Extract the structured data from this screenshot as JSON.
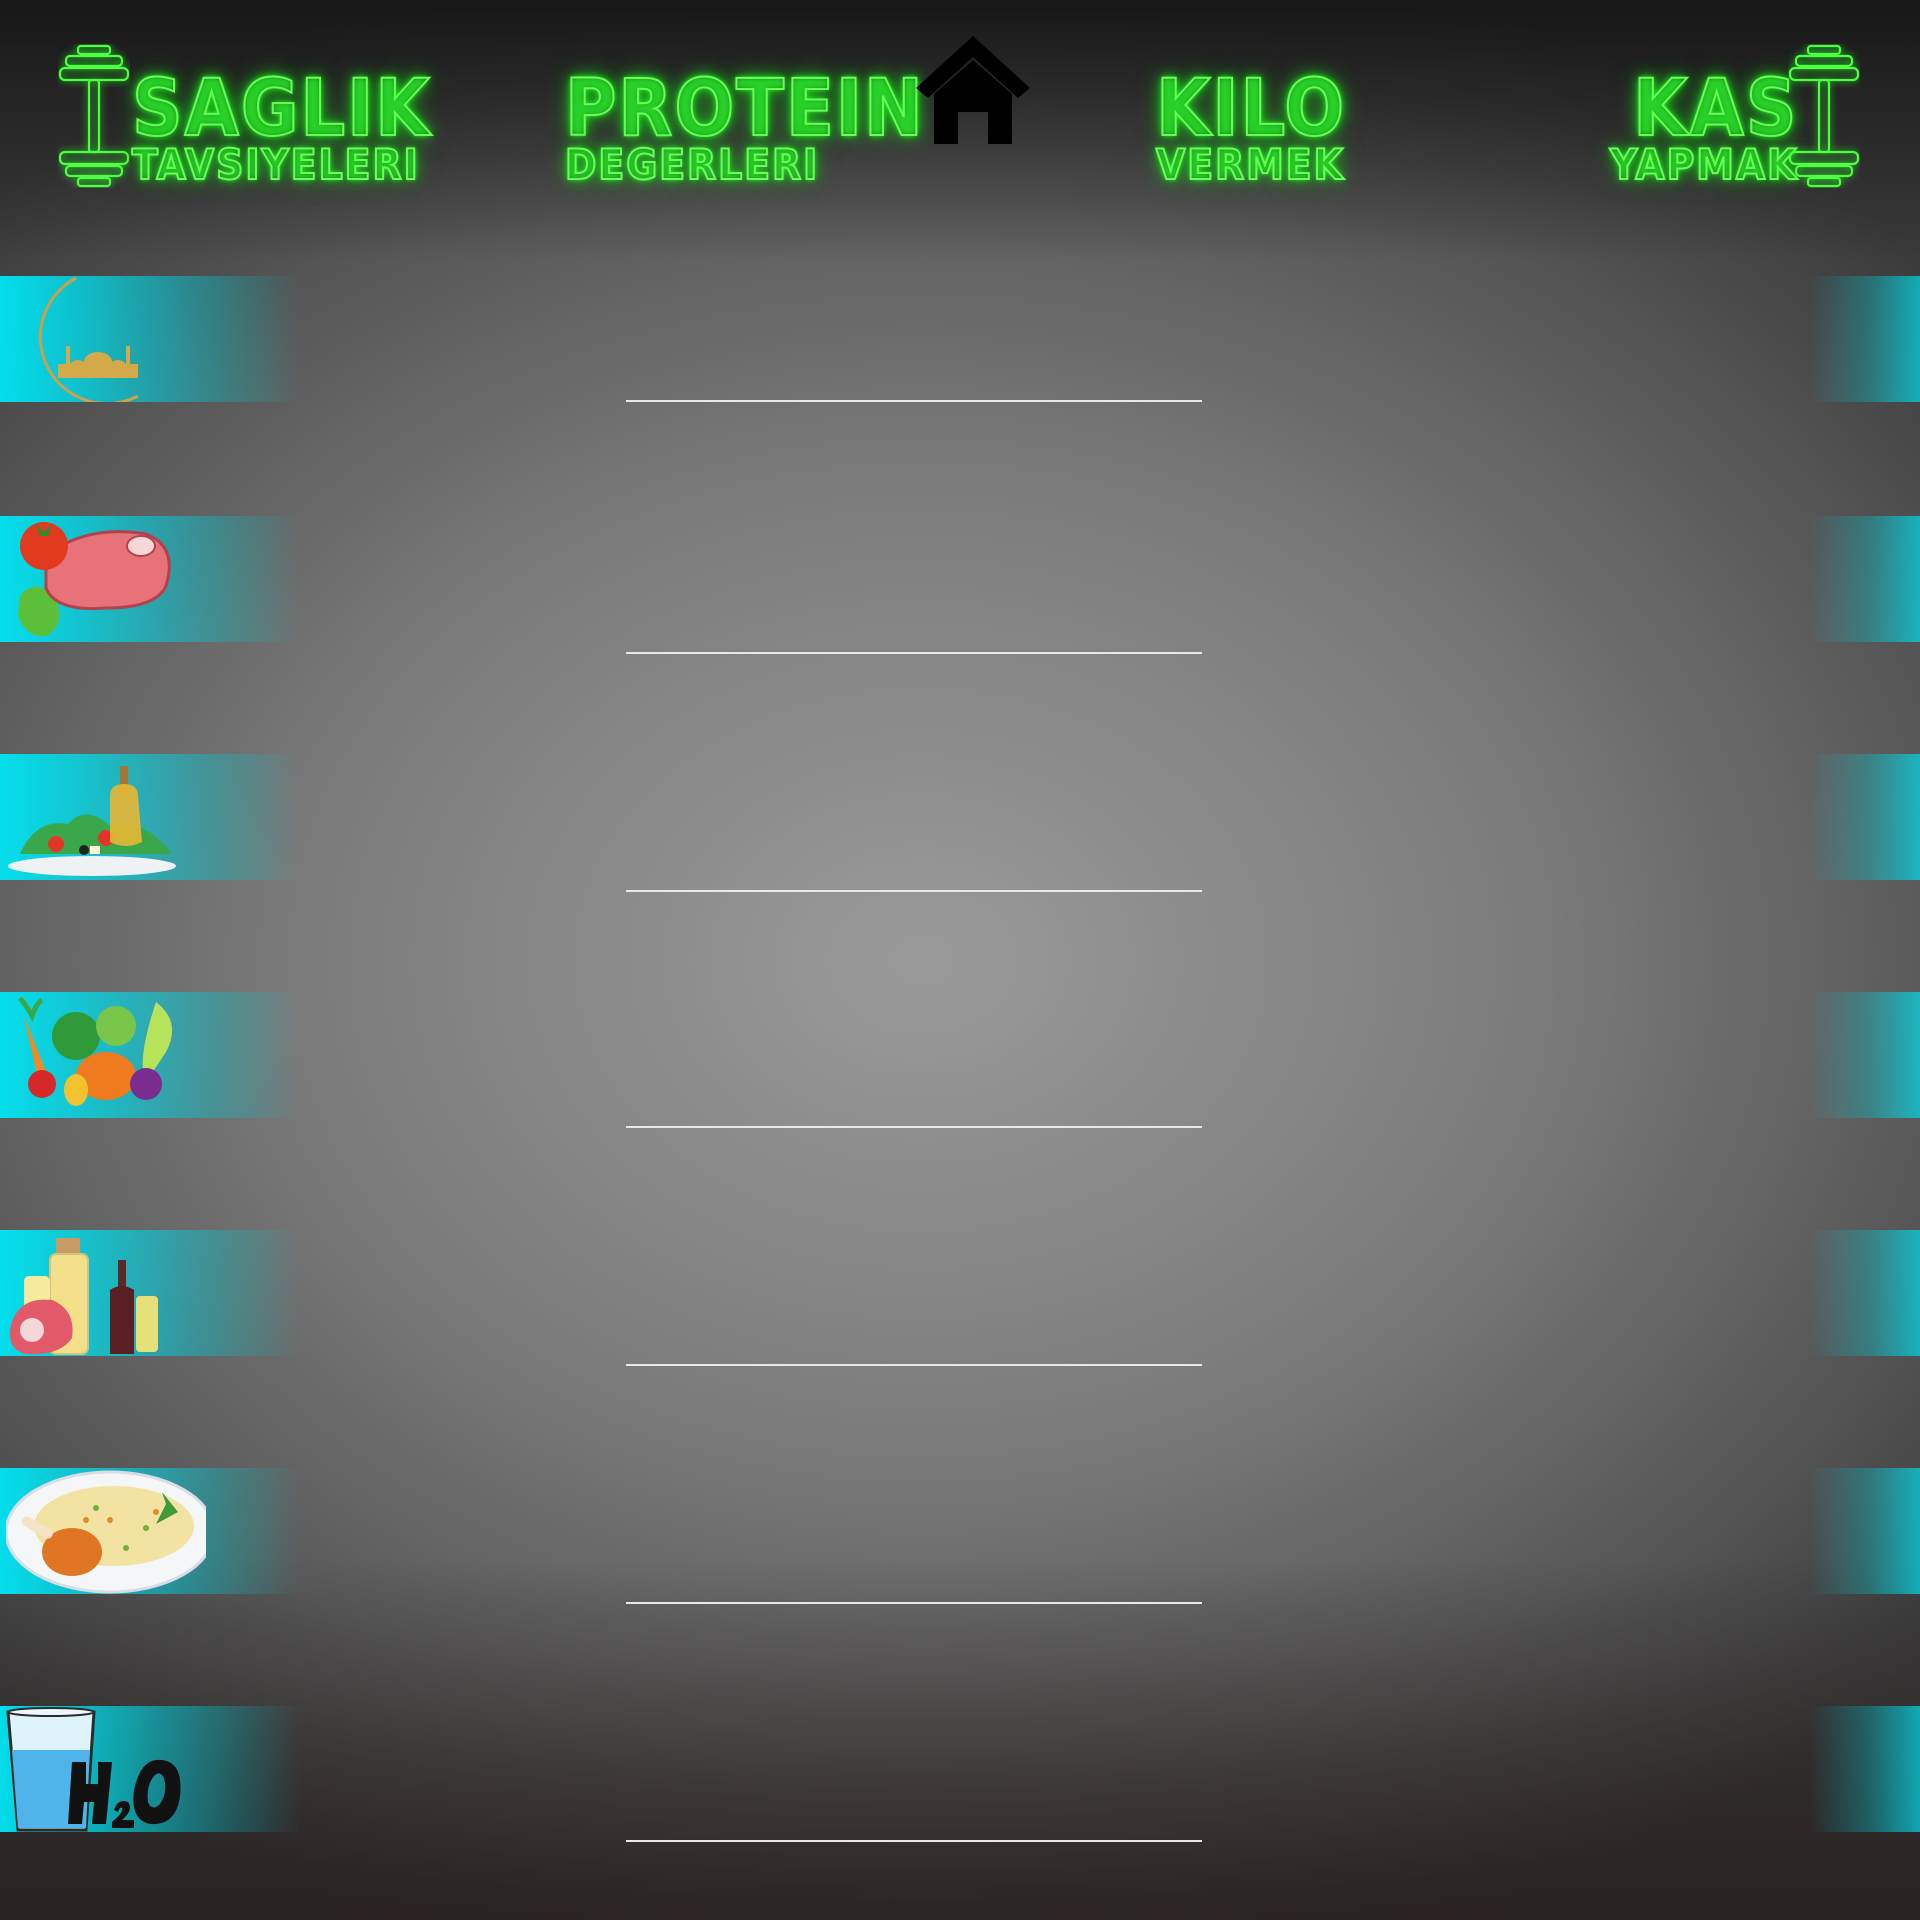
{
  "nav": {
    "health": {
      "line1": "SAGLIK",
      "line2": "TAVSIYELERI"
    },
    "protein": {
      "line1": "PROTEIN",
      "line2": "DEGERLERI"
    },
    "weight": {
      "line1": "KILO",
      "line2": "VERMEK"
    },
    "muscle": {
      "line1": "KAS",
      "line2": "YAPMAK"
    },
    "home_icon": "home-icon",
    "dumbbell_icon": "dumbbell-icon"
  },
  "rows": [
    {
      "icon": "crescent-mosque-icon",
      "label": ""
    },
    {
      "icon": "meat-tomato-icon",
      "label": ""
    },
    {
      "icon": "salad-oil-icon",
      "label": ""
    },
    {
      "icon": "vegetables-icon",
      "label": ""
    },
    {
      "icon": "oils-meat-icon",
      "label": ""
    },
    {
      "icon": "chicken-rice-icon",
      "label": ""
    },
    {
      "icon": "water-glass-h2o-icon",
      "label": ""
    }
  ],
  "colors": {
    "neon_green": "#66ff55",
    "accent_cyan": "#00e6f5",
    "divider": "#e8e8e8",
    "home_icon": "#000000"
  }
}
